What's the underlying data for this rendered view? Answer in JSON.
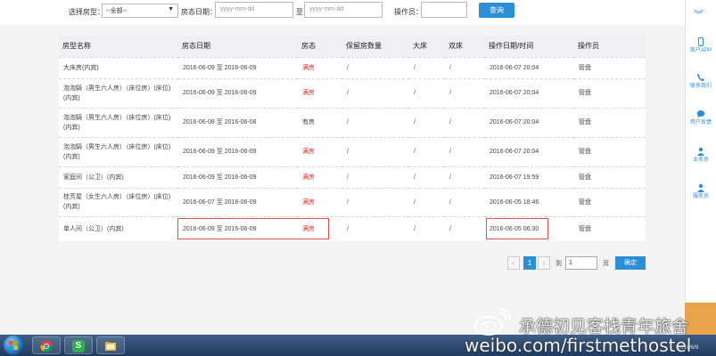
{
  "filter": {
    "room_type_label": "选择房型：",
    "room_type_value": "--全部--",
    "date_label": "房态日期：",
    "date_from_placeholder": "yyyy-mm-dd",
    "date_sep": "至",
    "date_to_placeholder": "yyyy-mm-dd",
    "operator_label": "操作员：",
    "operator_value": "",
    "query_button": "查询"
  },
  "table": {
    "headers": [
      "房型名称",
      "房态日期",
      "房态",
      "保留房数量",
      "大床",
      "双床",
      "操作日期/时间",
      "操作员"
    ],
    "rows": [
      {
        "name": "大床房(内宾)",
        "dates": "2016-06-09 至 2016-06-09",
        "status": "满房",
        "full": true,
        "reserved": "/",
        "big": "/",
        "twin": "/",
        "optime": "2016-06-07 20:04",
        "operator": "管盘"
      },
      {
        "name": "泡泡騎（男生六人房）（床位房）(床位)(内宾)",
        "dates": "2016-06-09 至 2016-06-09",
        "status": "满房",
        "full": true,
        "reserved": "/",
        "big": "/",
        "twin": "/",
        "optime": "2016-06-07 20:04",
        "operator": "管盘"
      },
      {
        "name": "泡泡騎（男生六人房）（床位房）(床位)(内宾)",
        "dates": "2016-06-08 至 2016-06-08",
        "status": "有房",
        "full": false,
        "reserved": "/",
        "big": "/",
        "twin": "/",
        "optime": "2016-06-07 20:04",
        "operator": "管盘"
      },
      {
        "name": "泡泡騎（男生六人房）（床位房）(床位)(内宾)",
        "dates": "2016-06-09 至 2016-06-09",
        "status": "满房",
        "full": true,
        "reserved": "/",
        "big": "/",
        "twin": "/",
        "optime": "2016-06-07 20:04",
        "operator": "管盘"
      },
      {
        "name": "家庭间（公卫）(内宾)",
        "dates": "2016-06-09 至 2016-06-09",
        "status": "满房",
        "full": true,
        "reserved": "/",
        "big": "/",
        "twin": "/",
        "optime": "2016-06-07 19:59",
        "operator": "管盘"
      },
      {
        "name": "桂芳屋（女生六人房）（床位房）(床位)(内宾)",
        "dates": "2016-06-07 至 2016-06-09",
        "status": "满房",
        "full": true,
        "reserved": "/",
        "big": "/",
        "twin": "/",
        "optime": "2016-06-05 18:46",
        "operator": "管盘"
      },
      {
        "name": "单人间（公卫）(内宾)",
        "dates": "2016-06-09 至 2016-06-09",
        "status": "满房",
        "full": true,
        "reserved": "/",
        "big": "/",
        "twin": "/",
        "optime": "2016-06-05 06:30",
        "operator": "管盘"
      }
    ]
  },
  "pager": {
    "prev": "‹",
    "current": "1",
    "next": "›",
    "to_label": "到",
    "page_input": "1",
    "page_label": "页",
    "ok": "确定"
  },
  "side": {
    "items": [
      {
        "label": "商户APP",
        "icon": "phone-icon"
      },
      {
        "label": "联系我们",
        "icon": "phone-call-icon"
      },
      {
        "label": "用户反馈",
        "icon": "chat-icon"
      },
      {
        "label": "业务员",
        "icon": "user-icon"
      },
      {
        "label": "服务员",
        "icon": "user-icon"
      }
    ]
  },
  "taskbar": {
    "app_s_letter": "S",
    "date": "2016/6/9"
  },
  "watermark": {
    "line1": "承德初见客栈青年旅舍",
    "line2": "weibo.com/firstmethostel"
  },
  "colors": {
    "accent": "#2a8fd6",
    "full_status": "#e0301e",
    "highlight": "#e5524a"
  }
}
